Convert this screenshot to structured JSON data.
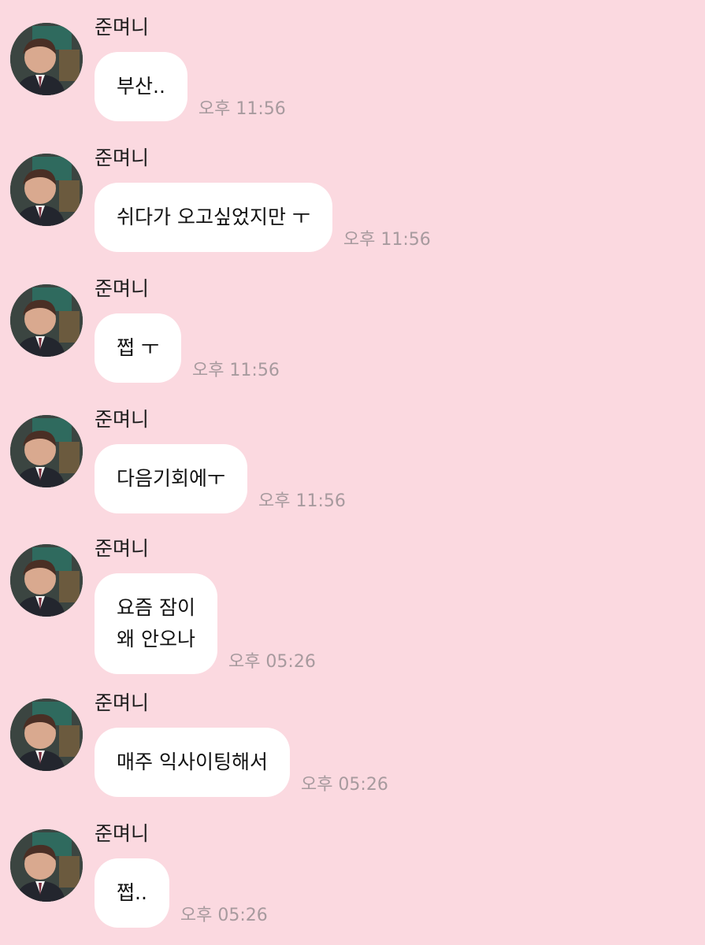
{
  "sender_name": "준며니",
  "messages": [
    {
      "text": "부산..",
      "time": "오후 11:56"
    },
    {
      "text": "쉬다가 오고싶었지만 ㅜ",
      "time": "오후 11:56"
    },
    {
      "text": "쩝 ㅜ",
      "time": "오후 11:56"
    },
    {
      "text": "다음기회에ㅜ",
      "time": "오후 11:56"
    },
    {
      "text": "요즘 잠이\n왜 안오나",
      "time": "오후 05:26"
    },
    {
      "text": "매주 익사이팅해서",
      "time": "오후 05:26"
    },
    {
      "text": "쩝..",
      "time": "오후 05:26"
    }
  ],
  "colors": {
    "background": "#fbd9e0",
    "bubble": "#ffffff",
    "time_text": "#a79a9e"
  },
  "icons": {
    "avatar": "profile-photo"
  }
}
